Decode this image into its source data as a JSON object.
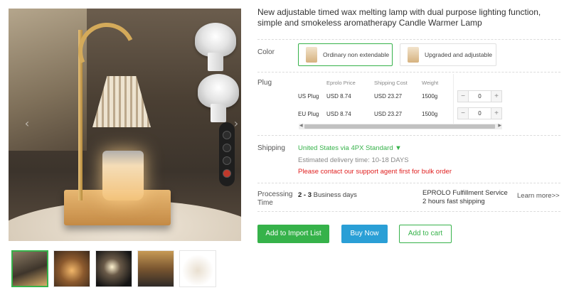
{
  "product": {
    "title": "New adjustable timed wax melting lamp with dual purpose lighting function, simple and smokeless aromatherapy Candle Warmer Lamp"
  },
  "gallery": {
    "prev_arrow": "‹",
    "next_arrow": "›",
    "thumbnails": [
      {
        "label": "thumbnail-1",
        "active": true
      },
      {
        "label": "thumbnail-2",
        "active": false
      },
      {
        "label": "thumbnail-3",
        "active": false
      },
      {
        "label": "thumbnail-4",
        "active": false
      },
      {
        "label": "thumbnail-5",
        "active": false
      }
    ]
  },
  "color": {
    "label": "Color",
    "options": [
      {
        "label": "Ordinary non extendable",
        "selected": true
      },
      {
        "label": "Upgraded and adjustable",
        "selected": false
      }
    ]
  },
  "plug": {
    "label": "Plug",
    "columns": [
      "Eprolo Price",
      "Shipping Cost",
      "Weight"
    ],
    "rows": [
      {
        "name": "US Plug",
        "price": "USD 8.74",
        "shipping": "USD 23.27",
        "weight": "1500g",
        "qty": "0"
      },
      {
        "name": "EU Plug",
        "price": "USD 8.74",
        "shipping": "USD 23.27",
        "weight": "1500g",
        "qty": "0"
      }
    ],
    "minus": "−",
    "plus": "+",
    "scroll_left": "◀",
    "scroll_right": "▶"
  },
  "shipping": {
    "label": "Shipping",
    "method": "United States via 4PX Standard ▼",
    "estimate": "Estimated delivery time: 10-18 DAYS",
    "warning": "Please contact our support agent first for bulk order"
  },
  "processing": {
    "label_line1": "Processing",
    "label_line2": "Time",
    "range": "2 - 3",
    "unit": " Business days",
    "fulfillment_line1": "EPROLO Fulfillment Service",
    "fulfillment_line2": "2 hours fast shipping",
    "learn_more": "Learn more>>"
  },
  "actions": {
    "import": "Add to Import List",
    "buy": "Buy Now",
    "cart": "Add to cart"
  },
  "colors": {
    "accent_green": "#36b24a",
    "buy_blue": "#2a9fd6",
    "warning_red": "#e02020"
  }
}
